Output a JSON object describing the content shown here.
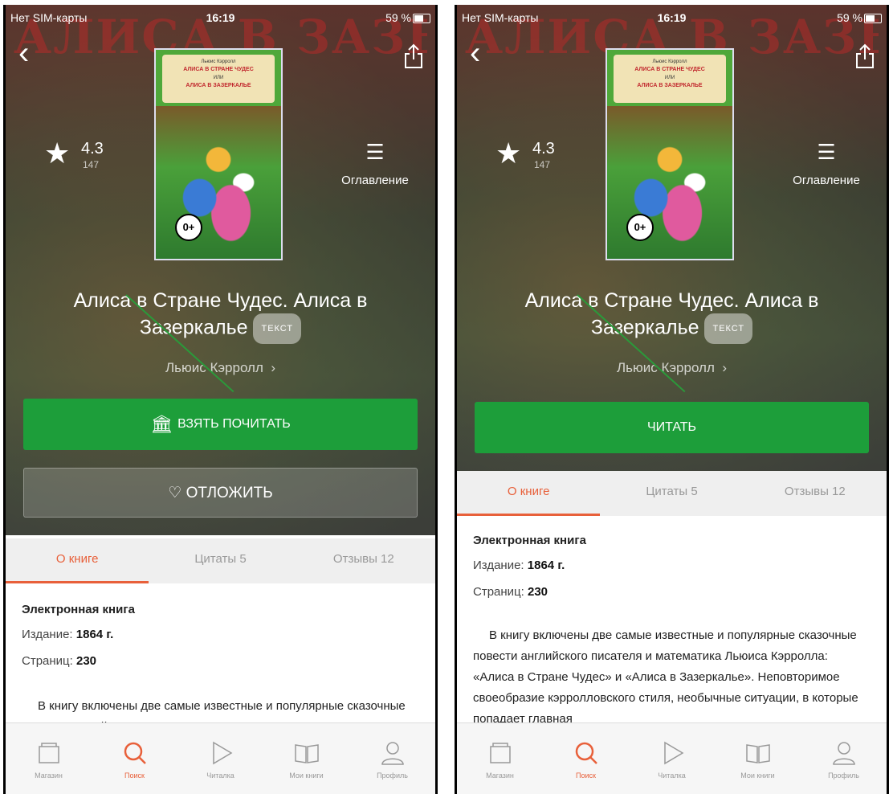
{
  "left": {
    "status": {
      "carrier": "Нет SIM-карты",
      "time": "16:19",
      "battery": "59 %"
    },
    "cover": {
      "author": "Льюис Кэрролл",
      "title1": "АЛИСА В СТРАНЕ ЧУДЕС",
      "sep": "ИЛИ",
      "title2": "АЛИСА В ЗАЗЕРКАЛЬЕ",
      "age": "0+"
    },
    "rating": {
      "value": "4.3",
      "count": "147"
    },
    "toc_label": "Оглавление",
    "title": "Алиса в Стране Чудес. Алиса в Зазеркалье",
    "badge": "ТЕКСТ",
    "author": "Льюис Кэрролл",
    "primary_button": "ВЗЯТЬ ПОЧИТАТЬ",
    "secondary_button": "ОТЛОЖИТЬ",
    "tabs": [
      "О книге",
      "Цитаты 5",
      "Отзывы 12"
    ],
    "info": {
      "heading": "Электронная книга",
      "edition_label": "Издание:",
      "edition_value": "1864 г.",
      "pages_label": "Страниц:",
      "pages_value": "230"
    },
    "description": "В книгу включены две самые известные и популярные сказочные повести английского писателя и математика Льюиса Кэрролла: «Алиса в Стране Чудес» и «Алиса в За-"
  },
  "right": {
    "status": {
      "carrier": "Нет SIM-карты",
      "time": "16:19",
      "battery": "59 %"
    },
    "cover": {
      "author": "Льюис Кэрролл",
      "title1": "АЛИСА В СТРАНЕ ЧУДЕС",
      "sep": "ИЛИ",
      "title2": "АЛИСА В ЗАЗЕРКАЛЬЕ",
      "age": "0+"
    },
    "rating": {
      "value": "4.3",
      "count": "147"
    },
    "toc_label": "Оглавление",
    "title": "Алиса в Стране Чудес. Алиса в Зазеркалье",
    "badge": "ТЕКСТ",
    "author": "Льюис Кэрролл",
    "primary_button": "ЧИТАТЬ",
    "tabs": [
      "О книге",
      "Цитаты 5",
      "Отзывы 12"
    ],
    "info": {
      "heading": "Электронная книга",
      "edition_label": "Издание:",
      "edition_value": "1864 г.",
      "pages_label": "Страниц:",
      "pages_value": "230"
    },
    "description": "В книгу включены две самые известные и популярные сказочные повести английского писателя и математика Льюиса Кэрролла: «Алиса в Стране Чудес» и «Алиса в Зазеркалье». Неповторимое своеобразие кэрролловского стиля, необычные ситуации, в которые попадает главная"
  },
  "bottom_nav": [
    "Магазин",
    "Поиск",
    "Читалка",
    "Мои книги",
    "Профиль"
  ],
  "colors": {
    "accent": "#e8603a",
    "green": "#1d9e3a"
  },
  "icons": [
    "back-chevron-icon",
    "share-icon",
    "star-icon",
    "toc-icon",
    "bank-icon",
    "heart-icon",
    "store-icon",
    "search-icon",
    "play-icon",
    "book-icon",
    "profile-icon"
  ]
}
